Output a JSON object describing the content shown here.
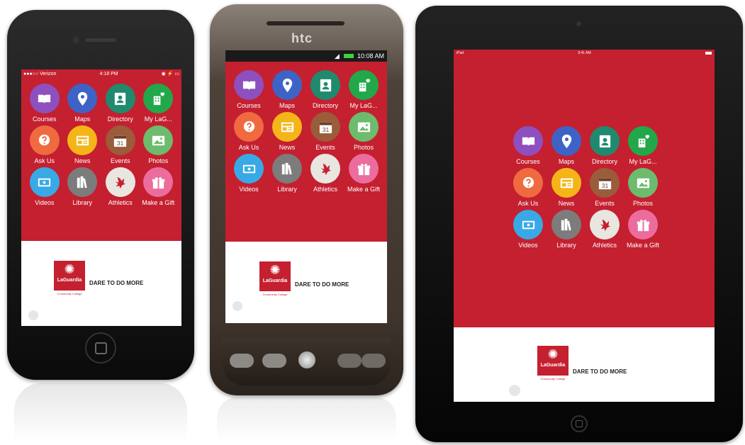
{
  "phones": {
    "iphone": {
      "status": {
        "carrier": "●●●○○ Verizon",
        "time": "4:18 PM",
        "right": "◉ ⚡ ▭"
      }
    },
    "htc": {
      "brand": "htc",
      "status": {
        "time": "10:08 AM"
      }
    },
    "ipad": {
      "status": {
        "left": "iPad",
        "time": "9:41 AM"
      }
    }
  },
  "tiles": [
    {
      "label": "Courses",
      "icon": "book-icon",
      "color": "#8e4fbf"
    },
    {
      "label": "Maps",
      "icon": "map-pin-icon",
      "color": "#3e63c7"
    },
    {
      "label": "Directory",
      "icon": "directory-icon",
      "color": "#1f8a6e"
    },
    {
      "label": "My LaG...",
      "icon": "mylag-icon",
      "color": "#22a84a"
    },
    {
      "label": "Ask Us",
      "icon": "question-icon",
      "color": "#f06a3f"
    },
    {
      "label": "News",
      "icon": "news-icon",
      "color": "#f5b518"
    },
    {
      "label": "Events",
      "icon": "calendar-icon",
      "color": "#9a5c3b"
    },
    {
      "label": "Photos",
      "icon": "photo-icon",
      "color": "#6dbb6c"
    },
    {
      "label": "Videos",
      "icon": "video-icon",
      "color": "#39a9e6"
    },
    {
      "label": "Library",
      "icon": "library-icon",
      "color": "#7c7c7c"
    },
    {
      "label": "Athletics",
      "icon": "athletics-icon",
      "color": "#e9e6e0"
    },
    {
      "label": "Make a Gift",
      "icon": "gift-icon",
      "color": "#ec6c9d"
    }
  ],
  "branding": {
    "logo_name": "LaGuardia",
    "logo_sub": "Community College",
    "tagline": "DARE TO DO MORE"
  },
  "colors": {
    "app_red": "#c42030",
    "bezel_black": "#111111",
    "htc_brown": "#5b4a3d"
  }
}
